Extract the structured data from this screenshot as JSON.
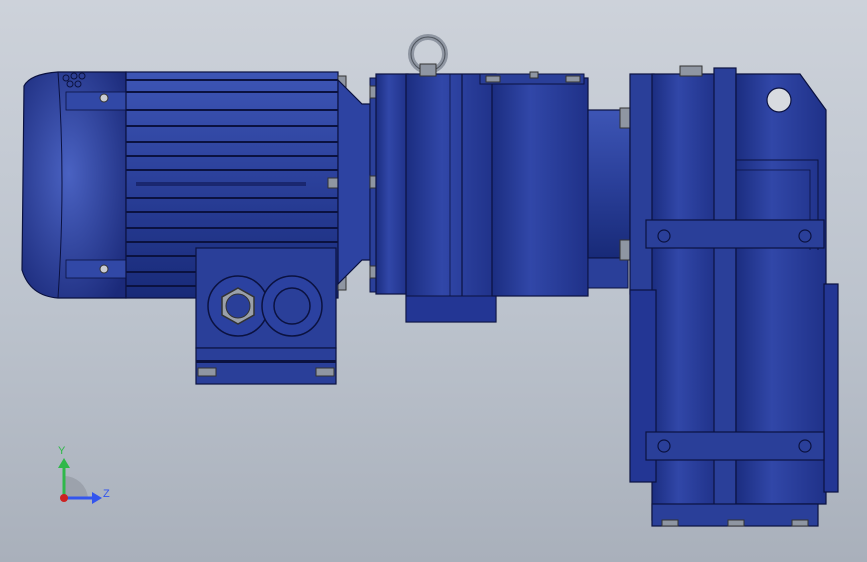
{
  "viewport": {
    "model": "gear-motor-assembly",
    "colors": {
      "body": "#2a3f99",
      "body_dark": "#14216a",
      "body_light": "#4a62c2",
      "steel": "#9aa0aa",
      "line": "#0b1240"
    }
  },
  "triad": {
    "y_label": "Y",
    "z_label": "Z",
    "colors": {
      "y": "#2fb84a",
      "z": "#3355ee",
      "x": "#cc2222"
    }
  }
}
